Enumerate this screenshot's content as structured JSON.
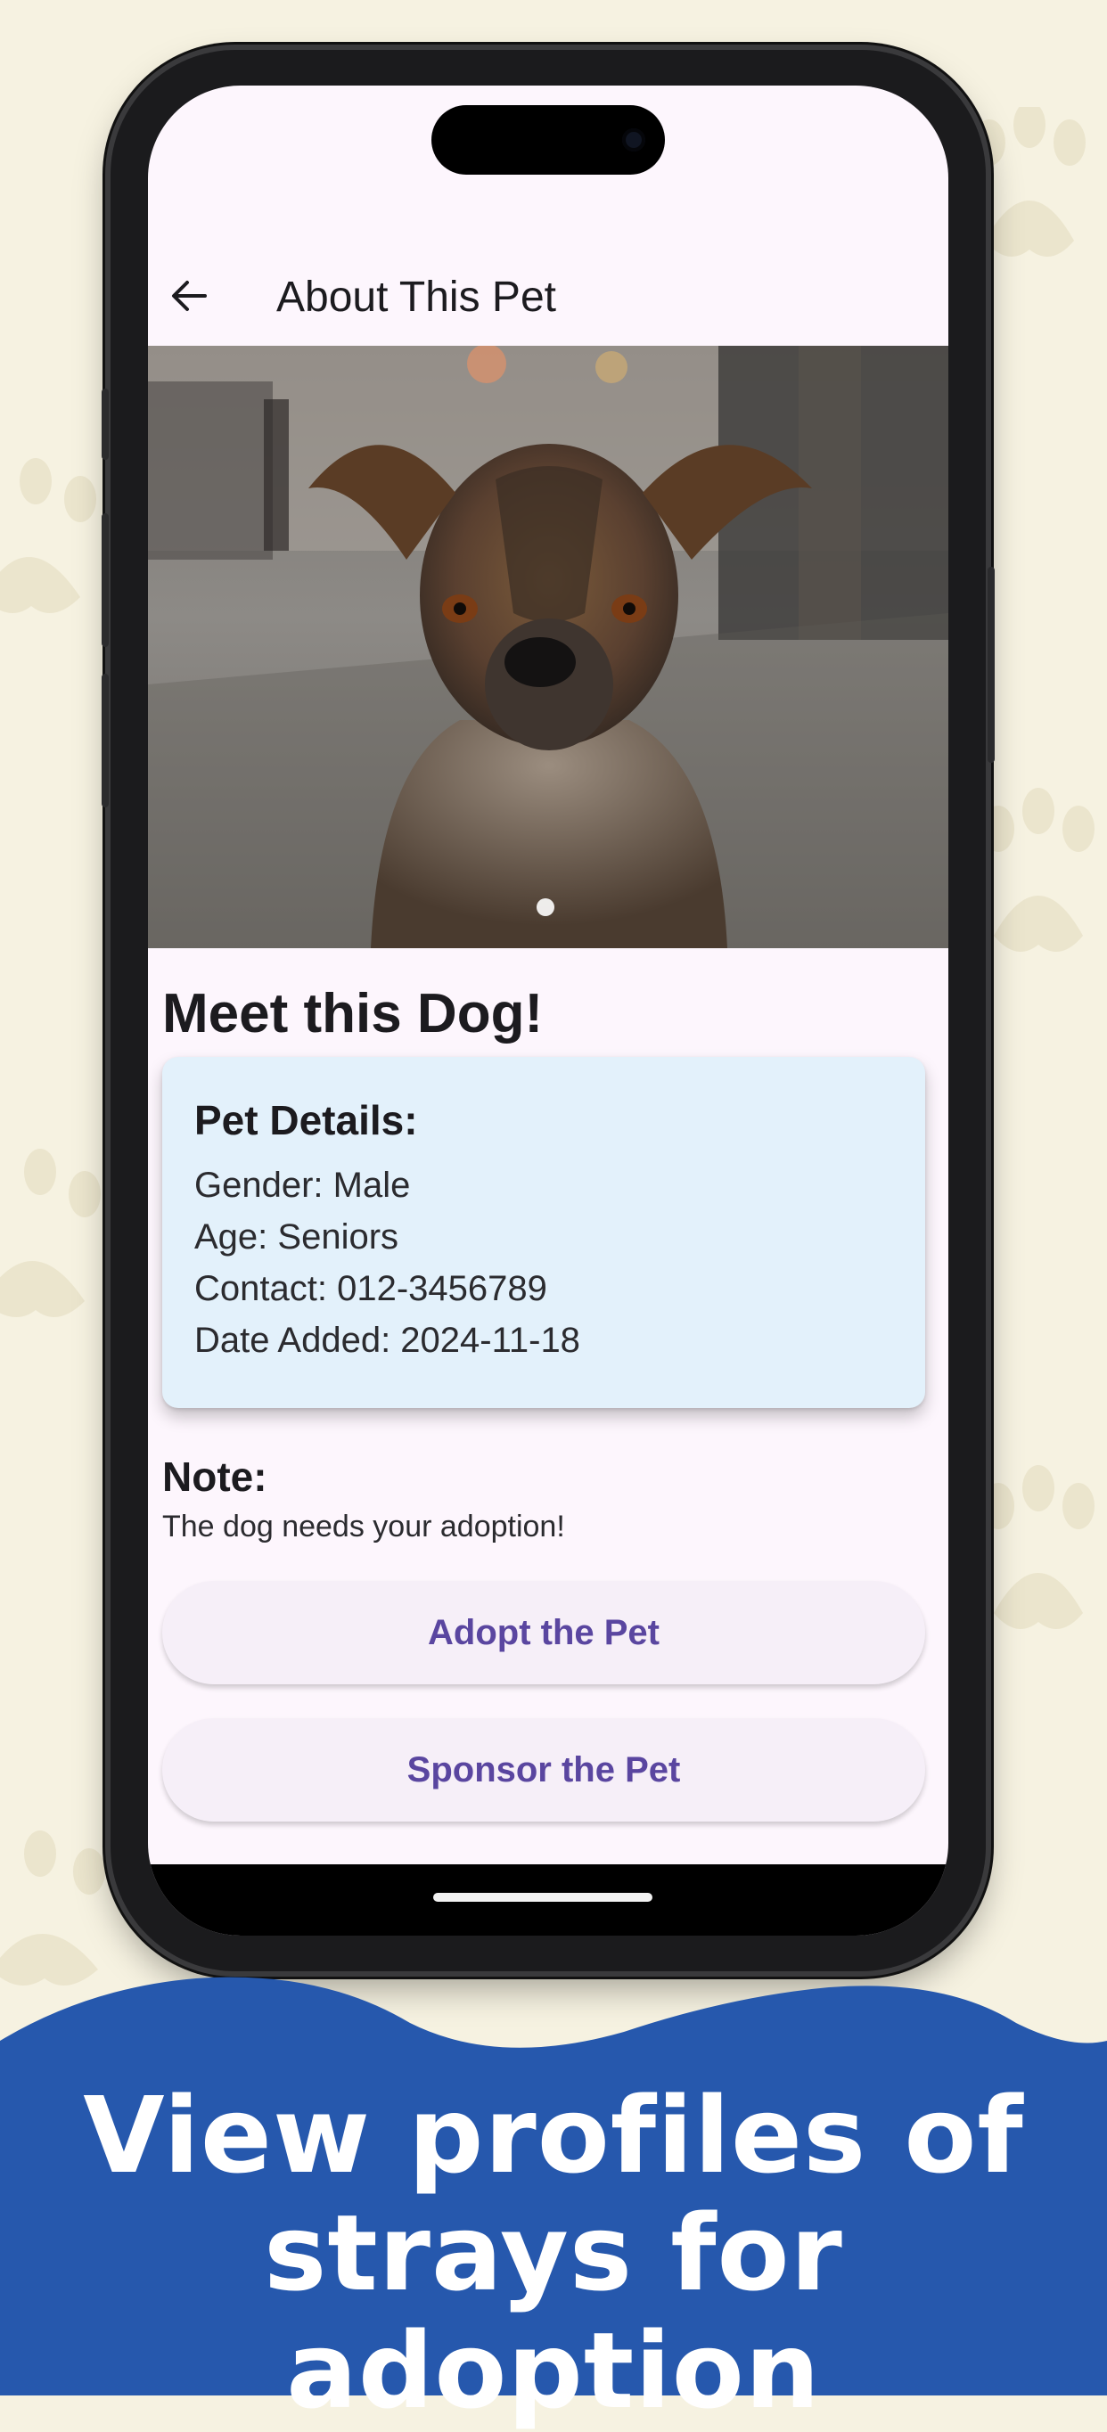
{
  "appbar": {
    "title": "About This Pet",
    "back_icon": "arrow-left-icon"
  },
  "hero": {
    "image": "dog photograph",
    "page_indicator": "1 of 1"
  },
  "main": {
    "heading": "Meet this Dog!",
    "details_card": {
      "title": "Pet Details:",
      "gender": "Gender: Male",
      "age": "Age: Seniors",
      "contact": "Contact: 012-3456789",
      "date_added": "Date Added: 2024-11-18"
    },
    "note_label": "Note:",
    "note_text": "The dog needs your adoption!",
    "adopt_label": "Adopt the Pet",
    "sponsor_label": "Sponsor the Pet"
  },
  "banner": {
    "line1": "View profiles of",
    "line2": "strays for adoption"
  },
  "colors": {
    "background": "#f6f2e1",
    "banner": "#2658ad",
    "card": "#e3f1fb",
    "button_text": "#5a46a0"
  }
}
